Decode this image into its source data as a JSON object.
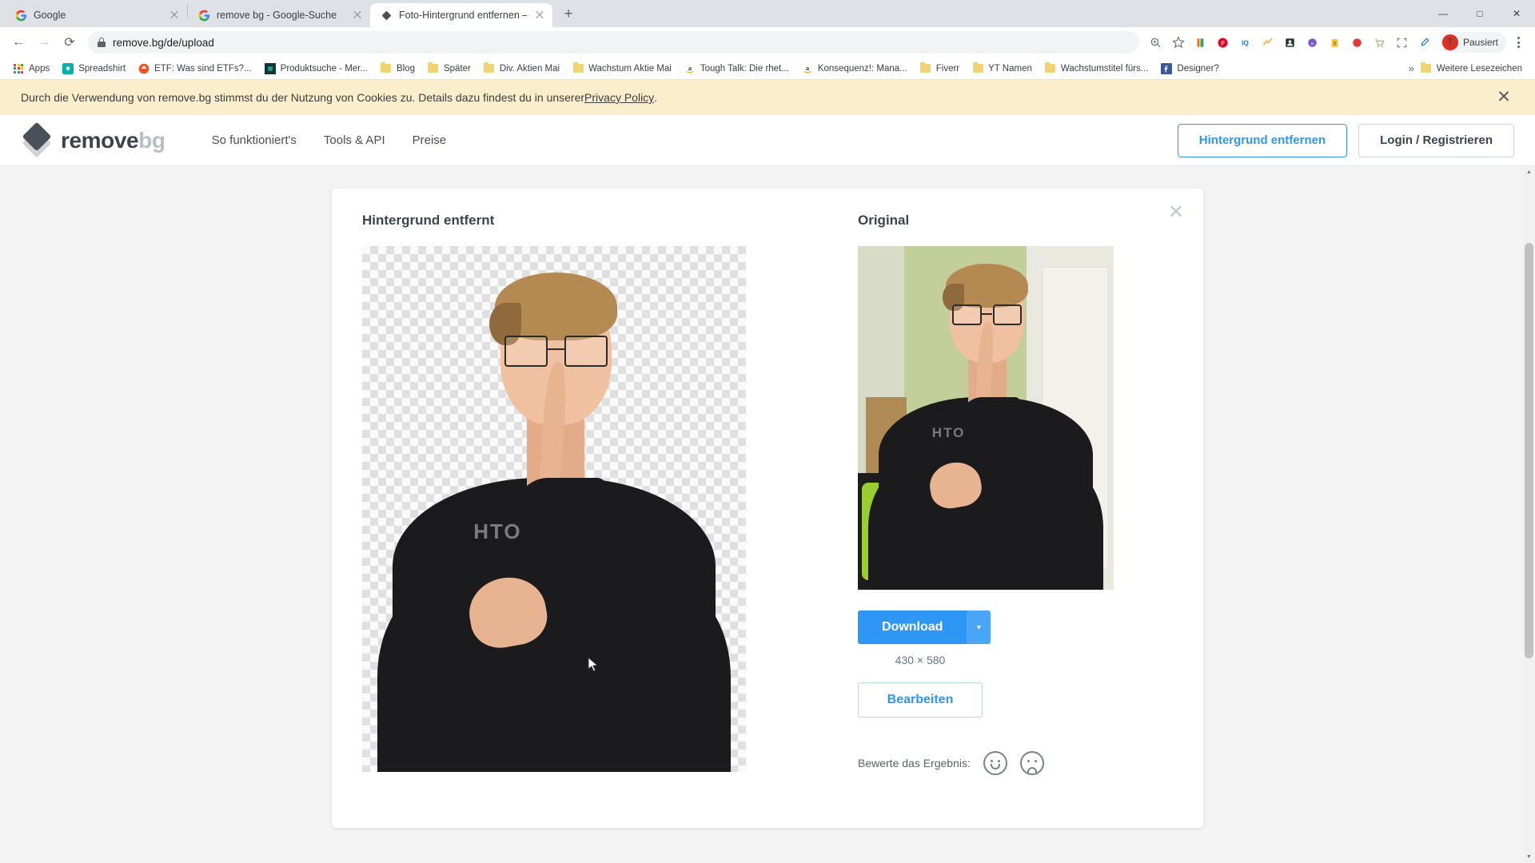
{
  "browser": {
    "tabs": [
      {
        "title": "Google",
        "favicon": "google-icon",
        "active": false
      },
      {
        "title": "remove bg - Google-Suche",
        "favicon": "google-icon",
        "active": false
      },
      {
        "title": "Foto-Hintergrund entfernen – re",
        "favicon": "removebg-icon",
        "active": true
      }
    ],
    "new_tab_label": "+",
    "window_controls": {
      "minimize": "—",
      "maximize": "□",
      "close": "✕"
    },
    "nav": {
      "back": "←",
      "forward": "→",
      "reload": "⟳"
    },
    "omnibox": {
      "url": "remove.bg/de/upload",
      "lock": "lock-icon"
    },
    "toolbar_icons": [
      "zoom-icon",
      "star-icon",
      "extension-rainbow-icon",
      "extension-pinterest-icon",
      "extension-iq-icon",
      "extension-lightning-icon",
      "extension-dark-icon",
      "extension-purple-icon",
      "extension-shopping-icon",
      "extension-red-icon",
      "extension-cart-icon",
      "fullscreen-icon",
      "eyedropper-icon"
    ],
    "profile": {
      "initial": "T",
      "label": "Pausiert"
    },
    "menu": "kebab-menu-icon",
    "bookmarks": [
      {
        "label": "Apps",
        "icon": "apps-grid-icon"
      },
      {
        "label": "Spreadshirt",
        "icon": "spreadshirt-icon"
      },
      {
        "label": "ETF: Was sind ETFs?...",
        "icon": "etf-icon"
      },
      {
        "label": "Produktsuche - Mer...",
        "icon": "produktsuche-icon"
      },
      {
        "label": "Blog",
        "icon": "folder-icon"
      },
      {
        "label": "Später",
        "icon": "folder-icon"
      },
      {
        "label": "Div. Aktien Mai",
        "icon": "folder-icon"
      },
      {
        "label": "Wachstum Aktie Mai",
        "icon": "folder-icon"
      },
      {
        "label": "Tough Talk: Die rhet...",
        "icon": "amazon-icon"
      },
      {
        "label": "Konsequenz!: Mana...",
        "icon": "amazon-icon"
      },
      {
        "label": "Fiverr",
        "icon": "folder-icon"
      },
      {
        "label": "YT Namen",
        "icon": "folder-icon"
      },
      {
        "label": "Wachstumstitel fürs...",
        "icon": "folder-icon"
      },
      {
        "label": "Designer?",
        "icon": "facebook-icon"
      }
    ],
    "bookmarks_overflow": "»",
    "other_bookmarks": {
      "label": "Weitere Lesezeichen",
      "icon": "folder-icon"
    }
  },
  "cookie_banner": {
    "text_before": "Durch die Verwendung von remove.bg stimmst du der Nutzung von Cookies zu. Details dazu findest du in unserer ",
    "link": "Privacy Policy",
    "text_after": ".",
    "close": "✕",
    "background": "#fbeecd"
  },
  "site_header": {
    "logo": {
      "name": "remove",
      "suffix": "bg"
    },
    "nav": [
      {
        "label": "So funktioniert's"
      },
      {
        "label": "Tools & API"
      },
      {
        "label": "Preise"
      }
    ],
    "actions": {
      "remove_bg": "Hintergrund entfernen",
      "login": "Login / Registrieren"
    },
    "accent_color": "#2e96f5"
  },
  "result_card": {
    "close": "✕",
    "left_title": "Hintergrund entfernt",
    "right_title": "Original",
    "download_button": "Download",
    "download_caret": "▾",
    "dimensions": "430 × 580",
    "edit_button": "Bearbeiten",
    "rating_label": "Bewerte das Ergebnis:",
    "rating_positive": "smiley-happy-icon",
    "rating_negative": "smiley-sad-icon",
    "subject_logo": "HTO"
  }
}
